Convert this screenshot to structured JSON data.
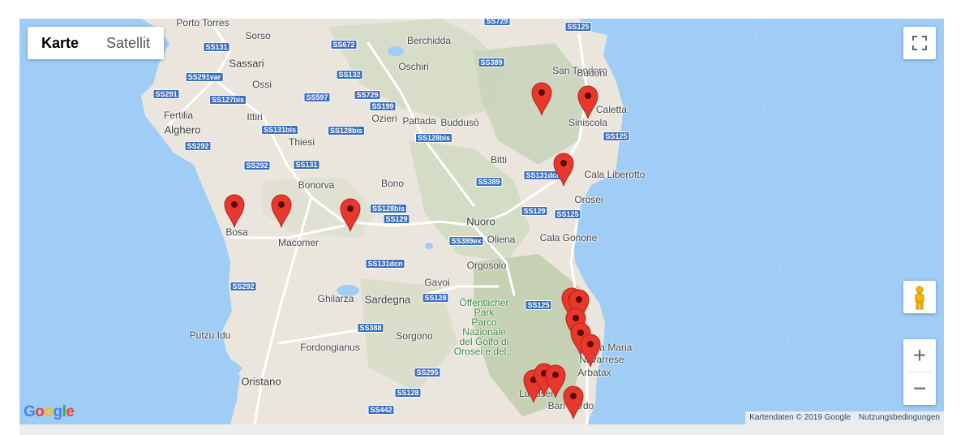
{
  "map_type": {
    "map_label": "Karte",
    "satellite_label": "Satellit",
    "active": "Karte"
  },
  "controls": {
    "fullscreen_icon": "fullscreen-icon",
    "pegman_icon": "pegman-icon",
    "zoom_in": "+",
    "zoom_out": "−"
  },
  "logo": {
    "text": "Google"
  },
  "attribution": {
    "data": "Kartendaten © 2019 Google",
    "terms": "Nutzungsbedingungen"
  },
  "colors": {
    "water": "#9fcdf5",
    "land": "#eae6de",
    "relief": "#cfd8c0",
    "road": "#ffffff",
    "shield": "#3b6fbf",
    "pin": "#e8372c"
  },
  "places": [
    {
      "key": "porto_torres",
      "text": "Porto Torres"
    },
    {
      "key": "sorso",
      "text": "Sorso"
    },
    {
      "key": "sassari",
      "text": "Sassari",
      "big": true
    },
    {
      "key": "ossi",
      "text": "Ossi"
    },
    {
      "key": "fertilia",
      "text": "Fertilia"
    },
    {
      "key": "alghero",
      "text": "Alghero",
      "big": true
    },
    {
      "key": "ittiri",
      "text": "Ittiri"
    },
    {
      "key": "thiesi",
      "text": "Thiesi"
    },
    {
      "key": "berchidda",
      "text": "Berchidda"
    },
    {
      "key": "oschiri",
      "text": "Oschiri"
    },
    {
      "key": "ozieri",
      "text": "Ozieri"
    },
    {
      "key": "pattada",
      "text": "Pattada"
    },
    {
      "key": "budduso",
      "text": "Buddusò"
    },
    {
      "key": "bitti",
      "text": "Bitti"
    },
    {
      "key": "bono",
      "text": "Bono"
    },
    {
      "key": "bonorva",
      "text": "Bonorva"
    },
    {
      "key": "san_teodoro",
      "text": "San Teodoro"
    },
    {
      "key": "budoni",
      "text": "Budoni"
    },
    {
      "key": "caletta",
      "text": "Caletta"
    },
    {
      "key": "siniscola",
      "text": "Siniscola"
    },
    {
      "key": "cala_liberotto",
      "text": "Cala Liberotto"
    },
    {
      "key": "orosei",
      "text": "Orosei"
    },
    {
      "key": "nuoro",
      "text": "Nuoro",
      "big": true
    },
    {
      "key": "oliena",
      "text": "Oliena"
    },
    {
      "key": "cala_gonone",
      "text": "Cala Gonone"
    },
    {
      "key": "orgosolo",
      "text": "Orgosolo"
    },
    {
      "key": "bosa",
      "text": "Bosa"
    },
    {
      "key": "macomer",
      "text": "Macomer"
    },
    {
      "key": "ghilarza",
      "text": "Ghilarza"
    },
    {
      "key": "sardegna",
      "text": "Sardegna",
      "big": true
    },
    {
      "key": "gavoi",
      "text": "Gavoi"
    },
    {
      "key": "sorgono",
      "text": "Sorgono"
    },
    {
      "key": "putzu_idu",
      "text": "Putzu Idu"
    },
    {
      "key": "fordongianus",
      "text": "Fordongianus"
    },
    {
      "key": "oristano",
      "text": "Oristano",
      "big": true
    },
    {
      "key": "arbatax",
      "text": "Arbatax"
    },
    {
      "key": "bari_sardo",
      "text": "Bari Sardo"
    },
    {
      "key": "santa_maria",
      "text": "Santa Maria"
    },
    {
      "key": "navarrese",
      "text": "Navarrese"
    },
    {
      "key": "lanusei",
      "text": "Lanusei"
    },
    {
      "key": "park",
      "text": "Öffentlicher\nPark\nParco\nNazionale\ndel Golfo di\nOrosei e del...",
      "park": true
    }
  ],
  "roads": [
    "SS131",
    "SS672",
    "SS729",
    "SS125",
    "SS389",
    "SS291var",
    "SS132",
    "SS291",
    "SS127bis",
    "SS597",
    "SS729",
    "SS199",
    "SS131bis",
    "SS128bis",
    "SS128bis",
    "SS292",
    "SS292",
    "SS131",
    "SS131dcn",
    "SS389",
    "SS128bis",
    "SS129",
    "SS129",
    "SS125",
    "SS389ex",
    "SS131dcn",
    "SS292",
    "SS128",
    "SS125",
    "SS388",
    "SS295",
    "SS128",
    "SS442",
    "SS125"
  ],
  "markers": [
    "marker",
    "marker",
    "marker",
    "marker",
    "marker",
    "marker",
    "marker",
    "marker",
    "marker",
    "marker",
    "marker",
    "marker",
    "marker",
    "marker",
    "marker"
  ]
}
